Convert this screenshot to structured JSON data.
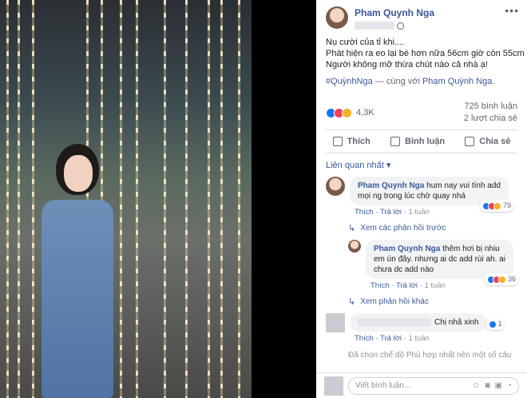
{
  "post": {
    "author": "Pham Quynh Nga",
    "text_lines": [
      "Nụ cười của tỉ khi....",
      "Phát hiện ra eo lại bé hơn nữa 56cm giờ còn 55cm",
      "Người không mỡ thừa chút nào cả nhà ạ!"
    ],
    "hashtag": "#QuỳnhNga",
    "with_text": " — cùng với ",
    "with_person": "Phạm Quỳnh Nga."
  },
  "stats": {
    "reaction_count": "4,3K",
    "comments": "725 bình luận",
    "shares": "2 lượt chia sẻ"
  },
  "actions": {
    "like": "Thích",
    "comment": "Bình luận",
    "share": "Chia sẻ"
  },
  "filter": "Liên quan nhất ▾",
  "comments": [
    {
      "name": "Pham Quynh Nga",
      "text_1": " hum nay vui tính add",
      "text_2": "mọi ng trong lúc chờ quay nhá",
      "reactions": "79",
      "like": "Thích",
      "reply": "Trả lời",
      "time": "1 tuần"
    },
    {
      "name": "Pham Quynh Nga",
      "text_1": " thêm hơi bị nhiu",
      "text_2": "em ún đây. nhưng ai dc add rùi ah. ai",
      "text_3": "chưa dc add nào",
      "reactions": "36",
      "like": "Thích",
      "reply": "Trả lời",
      "time": "1 tuần"
    },
    {
      "text": "Chị nhã xinh",
      "reactions": "1",
      "like": "Thích",
      "reply": "Trả lời",
      "time": "1 tuần"
    }
  ],
  "links": {
    "prev_replies": "Xem các phản hồi trước",
    "more_replies": "Xem phản hồi khác"
  },
  "truncated": "Đã chọn chế độ Phù hợp nhất nên một số câu",
  "composer": {
    "placeholder": "Viết bình luận..."
  }
}
